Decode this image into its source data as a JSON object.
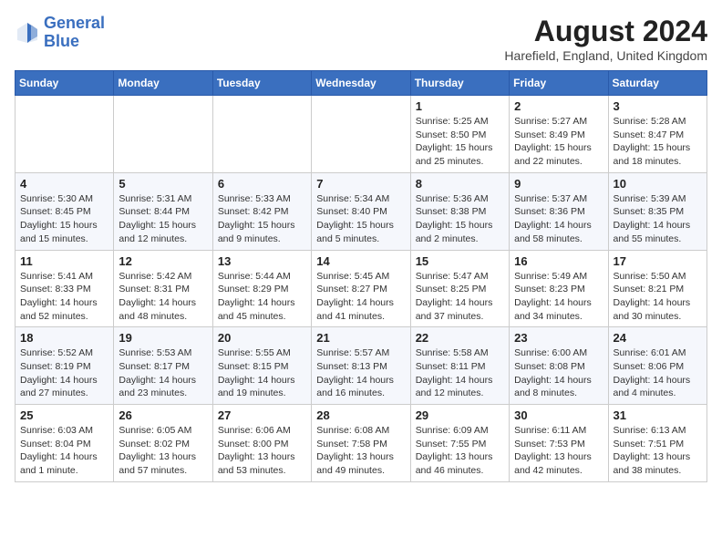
{
  "logo": {
    "line1": "General",
    "line2": "Blue"
  },
  "title": "August 2024",
  "location": "Harefield, England, United Kingdom",
  "weekdays": [
    "Sunday",
    "Monday",
    "Tuesday",
    "Wednesday",
    "Thursday",
    "Friday",
    "Saturday"
  ],
  "weeks": [
    [
      {
        "day": "",
        "text": ""
      },
      {
        "day": "",
        "text": ""
      },
      {
        "day": "",
        "text": ""
      },
      {
        "day": "",
        "text": ""
      },
      {
        "day": "1",
        "text": "Sunrise: 5:25 AM\nSunset: 8:50 PM\nDaylight: 15 hours\nand 25 minutes."
      },
      {
        "day": "2",
        "text": "Sunrise: 5:27 AM\nSunset: 8:49 PM\nDaylight: 15 hours\nand 22 minutes."
      },
      {
        "day": "3",
        "text": "Sunrise: 5:28 AM\nSunset: 8:47 PM\nDaylight: 15 hours\nand 18 minutes."
      }
    ],
    [
      {
        "day": "4",
        "text": "Sunrise: 5:30 AM\nSunset: 8:45 PM\nDaylight: 15 hours\nand 15 minutes."
      },
      {
        "day": "5",
        "text": "Sunrise: 5:31 AM\nSunset: 8:44 PM\nDaylight: 15 hours\nand 12 minutes."
      },
      {
        "day": "6",
        "text": "Sunrise: 5:33 AM\nSunset: 8:42 PM\nDaylight: 15 hours\nand 9 minutes."
      },
      {
        "day": "7",
        "text": "Sunrise: 5:34 AM\nSunset: 8:40 PM\nDaylight: 15 hours\nand 5 minutes."
      },
      {
        "day": "8",
        "text": "Sunrise: 5:36 AM\nSunset: 8:38 PM\nDaylight: 15 hours\nand 2 minutes."
      },
      {
        "day": "9",
        "text": "Sunrise: 5:37 AM\nSunset: 8:36 PM\nDaylight: 14 hours\nand 58 minutes."
      },
      {
        "day": "10",
        "text": "Sunrise: 5:39 AM\nSunset: 8:35 PM\nDaylight: 14 hours\nand 55 minutes."
      }
    ],
    [
      {
        "day": "11",
        "text": "Sunrise: 5:41 AM\nSunset: 8:33 PM\nDaylight: 14 hours\nand 52 minutes."
      },
      {
        "day": "12",
        "text": "Sunrise: 5:42 AM\nSunset: 8:31 PM\nDaylight: 14 hours\nand 48 minutes."
      },
      {
        "day": "13",
        "text": "Sunrise: 5:44 AM\nSunset: 8:29 PM\nDaylight: 14 hours\nand 45 minutes."
      },
      {
        "day": "14",
        "text": "Sunrise: 5:45 AM\nSunset: 8:27 PM\nDaylight: 14 hours\nand 41 minutes."
      },
      {
        "day": "15",
        "text": "Sunrise: 5:47 AM\nSunset: 8:25 PM\nDaylight: 14 hours\nand 37 minutes."
      },
      {
        "day": "16",
        "text": "Sunrise: 5:49 AM\nSunset: 8:23 PM\nDaylight: 14 hours\nand 34 minutes."
      },
      {
        "day": "17",
        "text": "Sunrise: 5:50 AM\nSunset: 8:21 PM\nDaylight: 14 hours\nand 30 minutes."
      }
    ],
    [
      {
        "day": "18",
        "text": "Sunrise: 5:52 AM\nSunset: 8:19 PM\nDaylight: 14 hours\nand 27 minutes."
      },
      {
        "day": "19",
        "text": "Sunrise: 5:53 AM\nSunset: 8:17 PM\nDaylight: 14 hours\nand 23 minutes."
      },
      {
        "day": "20",
        "text": "Sunrise: 5:55 AM\nSunset: 8:15 PM\nDaylight: 14 hours\nand 19 minutes."
      },
      {
        "day": "21",
        "text": "Sunrise: 5:57 AM\nSunset: 8:13 PM\nDaylight: 14 hours\nand 16 minutes."
      },
      {
        "day": "22",
        "text": "Sunrise: 5:58 AM\nSunset: 8:11 PM\nDaylight: 14 hours\nand 12 minutes."
      },
      {
        "day": "23",
        "text": "Sunrise: 6:00 AM\nSunset: 8:08 PM\nDaylight: 14 hours\nand 8 minutes."
      },
      {
        "day": "24",
        "text": "Sunrise: 6:01 AM\nSunset: 8:06 PM\nDaylight: 14 hours\nand 4 minutes."
      }
    ],
    [
      {
        "day": "25",
        "text": "Sunrise: 6:03 AM\nSunset: 8:04 PM\nDaylight: 14 hours\nand 1 minute."
      },
      {
        "day": "26",
        "text": "Sunrise: 6:05 AM\nSunset: 8:02 PM\nDaylight: 13 hours\nand 57 minutes."
      },
      {
        "day": "27",
        "text": "Sunrise: 6:06 AM\nSunset: 8:00 PM\nDaylight: 13 hours\nand 53 minutes."
      },
      {
        "day": "28",
        "text": "Sunrise: 6:08 AM\nSunset: 7:58 PM\nDaylight: 13 hours\nand 49 minutes."
      },
      {
        "day": "29",
        "text": "Sunrise: 6:09 AM\nSunset: 7:55 PM\nDaylight: 13 hours\nand 46 minutes."
      },
      {
        "day": "30",
        "text": "Sunrise: 6:11 AM\nSunset: 7:53 PM\nDaylight: 13 hours\nand 42 minutes."
      },
      {
        "day": "31",
        "text": "Sunrise: 6:13 AM\nSunset: 7:51 PM\nDaylight: 13 hours\nand 38 minutes."
      }
    ]
  ]
}
